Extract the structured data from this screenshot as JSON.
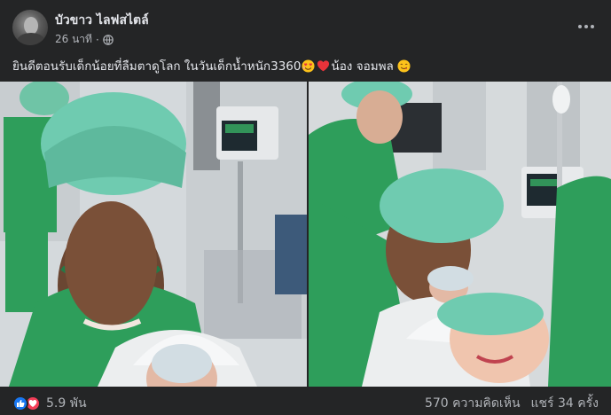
{
  "post": {
    "author": "บัวขาว ไลฟสไตล์",
    "timestamp": "26 นาที",
    "separator": "·",
    "audience_icon": "globe-icon",
    "more_icon": "more-options-icon",
    "caption_text_1": "ยินดีตอนรับเด็กน้อยที่ลืมตาดูโลก ในวันเด็กน้ำหนัก3360",
    "caption_text_2": "น้อง จอมพล",
    "caption_emojis": [
      "heart-eyes-face",
      "red-heart",
      "face-savoring-food"
    ]
  },
  "photos": [
    {
      "name": "photo-father-holding-newborn"
    },
    {
      "name": "photo-father-kissing-newborn-with-mother"
    }
  ],
  "footer": {
    "reaction_icons": [
      "like-icon",
      "love-icon"
    ],
    "reaction_count": "5.9 พัน",
    "comments": "570 ความคิดเห็น",
    "shares": "แชร์ 34 ครั้ง"
  },
  "colors": {
    "background": "#242526",
    "primary_text": "#e4e6eb",
    "secondary_text": "#b0b3b8",
    "like_blue": "#1877f2",
    "love_red": "#f33e58",
    "scrub_green": "#2e9e5b"
  }
}
